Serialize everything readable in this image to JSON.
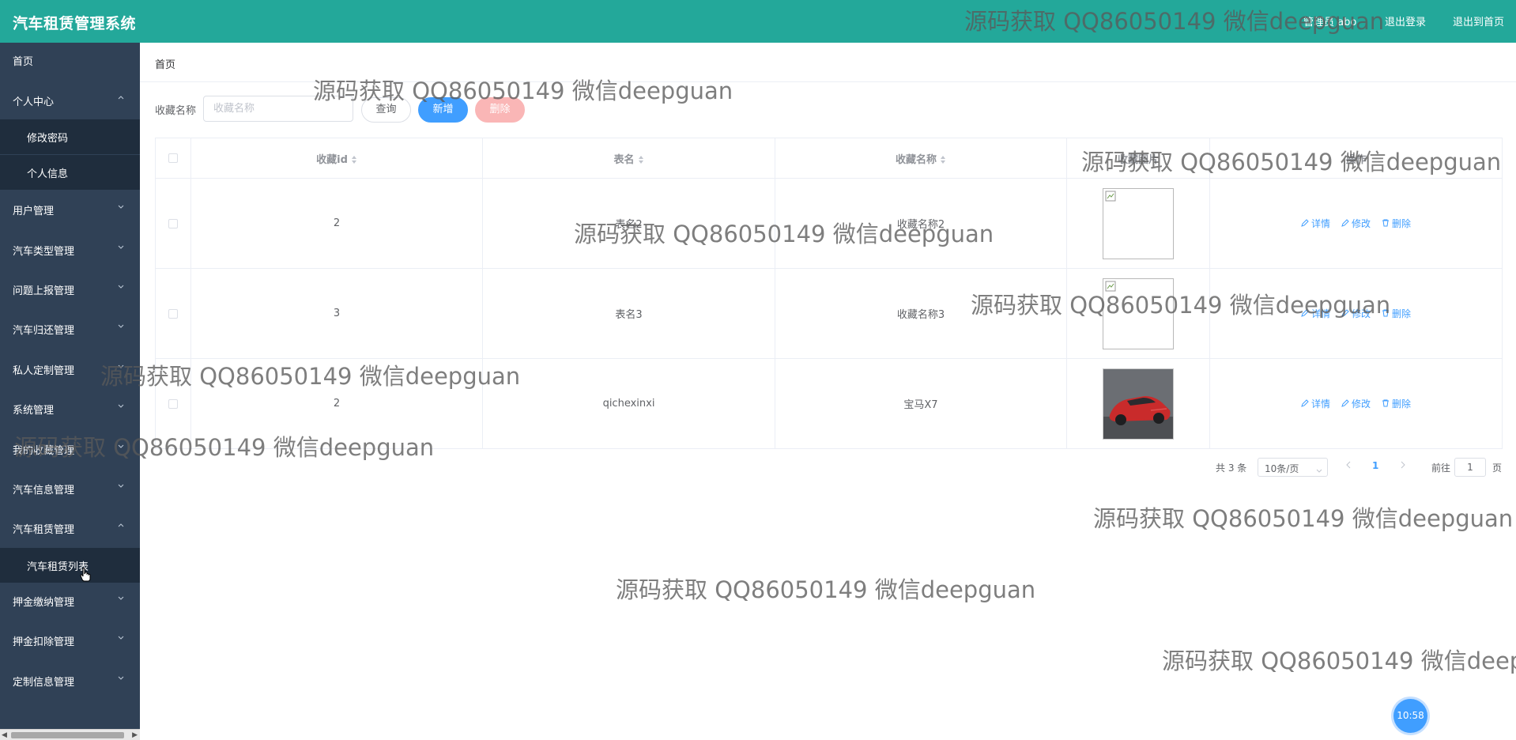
{
  "header": {
    "app_title": "汽车租赁管理系统",
    "user_text": "管理员 abo",
    "logout_label": "退出登录",
    "home_label": "退出到首页"
  },
  "sidebar": {
    "items": [
      {
        "label": "首页"
      },
      {
        "label": "个人中心"
      },
      {
        "label": "修改密码"
      },
      {
        "label": "个人信息"
      },
      {
        "label": "用户管理"
      },
      {
        "label": "汽车类型管理"
      },
      {
        "label": "问题上报管理"
      },
      {
        "label": "汽车归还管理"
      },
      {
        "label": "私人定制管理"
      },
      {
        "label": "系统管理"
      },
      {
        "label": "我的收藏管理"
      },
      {
        "label": "汽车信息管理"
      },
      {
        "label": "汽车租赁管理"
      },
      {
        "label": "汽车租赁列表"
      },
      {
        "label": "押金缴纳管理"
      },
      {
        "label": "押金扣除管理"
      },
      {
        "label": "定制信息管理"
      }
    ]
  },
  "breadcrumb": {
    "current": "首页"
  },
  "search": {
    "label": "收藏名称",
    "placeholder": "收藏名称",
    "query_label": "查询",
    "add_label": "新增",
    "delete_label": "删除"
  },
  "table": {
    "headers": [
      "收藏id",
      "表名",
      "收藏名称",
      "收藏图片",
      "操作"
    ],
    "rows": [
      {
        "id": "2",
        "table_name": "表名2",
        "name": "收藏名称2",
        "image": "broken"
      },
      {
        "id": "3",
        "table_name": "表名3",
        "name": "收藏名称3",
        "image": "broken"
      },
      {
        "id": "2",
        "table_name": "qichexinxi",
        "name": "宝马X7",
        "image": "car"
      }
    ],
    "ops": {
      "detail": "详情",
      "edit": "修改",
      "delete": "删除"
    }
  },
  "pagination": {
    "total": "共 3 条",
    "page_size": "10条/页",
    "current_page": "1",
    "goto_label": "前往",
    "goto_value": "1",
    "page_suffix": "页"
  },
  "clock": "10:58",
  "watermark": "源码获取 QQ86050149 微信deepguan",
  "colors": {
    "header_bg": "#23a89a",
    "sidebar_bg": "#304156",
    "primary": "#409eff",
    "danger_light": "#fab6b6"
  }
}
